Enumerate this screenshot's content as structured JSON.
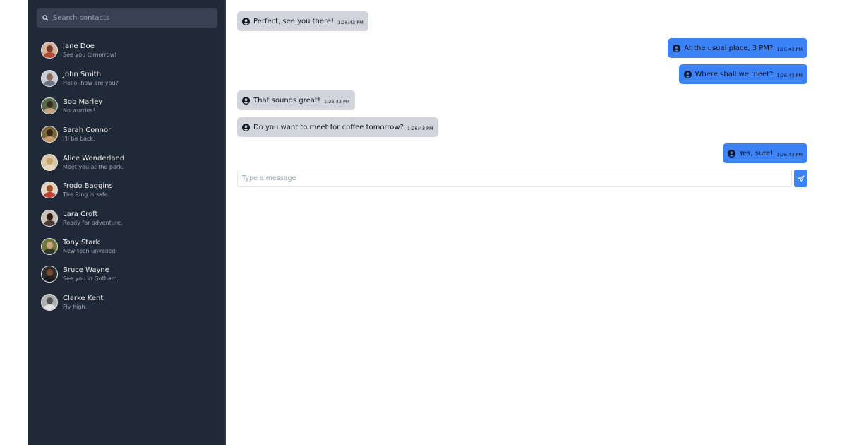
{
  "search": {
    "placeholder": "Search contacts"
  },
  "contacts": [
    {
      "name": "Jane Doe",
      "last": "See you tomorrow!"
    },
    {
      "name": "John Smith",
      "last": "Hello, how are you?"
    },
    {
      "name": "Bob Marley",
      "last": "No worries!"
    },
    {
      "name": "Sarah Connor",
      "last": "I'll be back."
    },
    {
      "name": "Alice Wonderland",
      "last": "Meet you at the park."
    },
    {
      "name": "Frodo Baggins",
      "last": "The Ring is safe."
    },
    {
      "name": "Lara Croft",
      "last": "Ready for adventure."
    },
    {
      "name": "Tony Stark",
      "last": "New tech unveiled."
    },
    {
      "name": "Bruce Wayne",
      "last": "See you in Gotham."
    },
    {
      "name": "Clarke Kent",
      "last": "Fly high."
    }
  ],
  "messages": [
    {
      "text": "Perfect, see you there!",
      "time": "1:26:43 PM",
      "dir": "in"
    },
    {
      "text": "At the usual place, 3 PM?",
      "time": "1:26:43 PM",
      "dir": "out"
    },
    {
      "text": "Where shall we meet?",
      "time": "1:26:43 PM",
      "dir": "out"
    },
    {
      "text": "That sounds great!",
      "time": "1:26:43 PM",
      "dir": "in"
    },
    {
      "text": "Do you want to meet for coffee tomorrow?",
      "time": "1:26:43 PM",
      "dir": "in"
    },
    {
      "text": "Yes, sure!",
      "time": "1:26:43 PM",
      "dir": "out"
    }
  ],
  "composer": {
    "placeholder": "Type a message"
  },
  "icons": {
    "search": "search-icon",
    "user": "user-circle-icon",
    "send": "send-icon"
  },
  "colors": {
    "sidebar": "#1f2937",
    "outgoing": "#3b82f6",
    "incoming": "#d1d5db",
    "accent": "#3b82f6"
  }
}
